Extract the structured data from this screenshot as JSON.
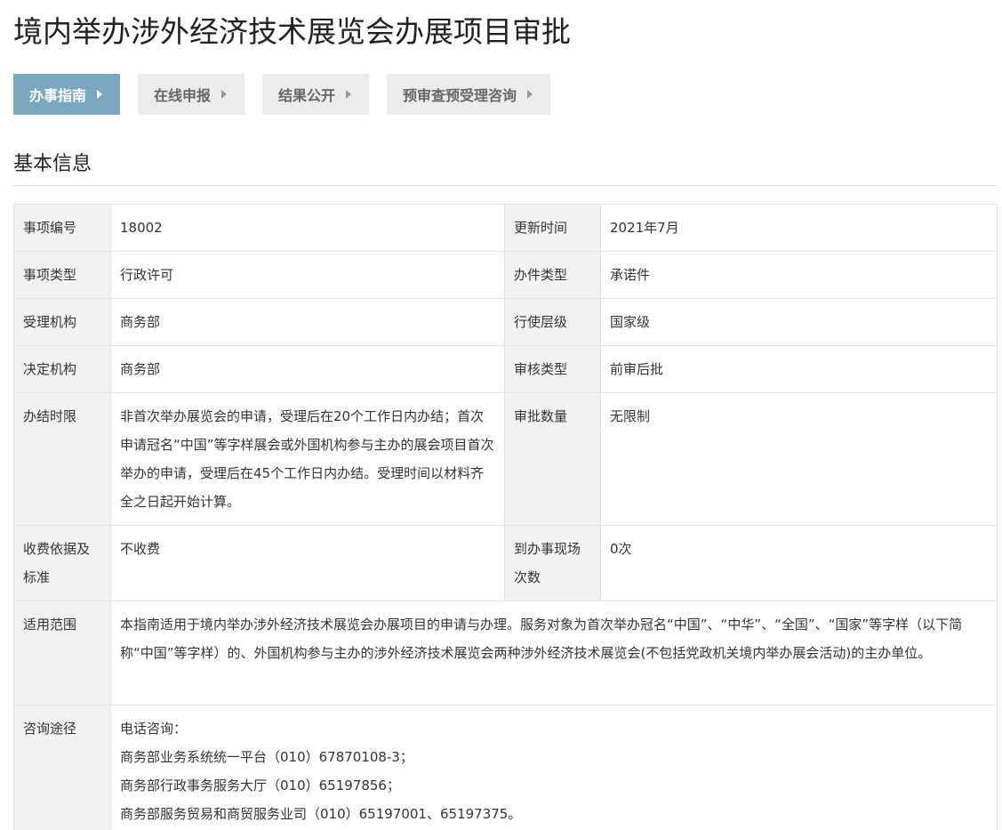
{
  "page_title": "境内举办涉外经济技术展览会办展项目审批",
  "tabs": [
    {
      "label": "办事指南",
      "active": true
    },
    {
      "label": "在线申报",
      "active": false
    },
    {
      "label": "结果公开",
      "active": false
    },
    {
      "label": "预审查预受理咨询",
      "active": false
    }
  ],
  "section_title": "基本信息",
  "info": {
    "item_no_label": "事项编号",
    "item_no": "18002",
    "update_time_label": "更新时间",
    "update_time": "2021年7月",
    "item_type_label": "事项类型",
    "item_type": "行政许可",
    "handle_type_label": "办件类型",
    "handle_type": "承诺件",
    "accept_org_label": "受理机构",
    "accept_org": "商务部",
    "level_label": "行使层级",
    "level": "国家级",
    "decide_org_label": "决定机构",
    "decide_org": "商务部",
    "review_type_label": "审核类型",
    "review_type": "前审后批",
    "time_limit_label": "办结时限",
    "time_limit": "非首次举办展览会的申请，受理后在20个工作日内办结；首次申请冠名“中国”等字样展会或外国机构参与主办的展会项目首次举办的申请，受理后在45个工作日内办结。受理时间以材料齐全之日起开始计算。",
    "approve_count_label": "审批数量",
    "approve_count": "无限制",
    "fee_label": "收费依据及标准",
    "fee": "不收费",
    "visits_label": "到办事现场次数",
    "visits": "0次",
    "scope_label": "适用范围",
    "scope": "本指南适用于境内举办涉外经济技术展览会办展项目的申请与办理。服务对象为首次举办冠名“中国”、“中华”、“全国”、“国家”等字样（以下简称“中国”等字样）的、外国机构参与主办的涉外经济技术展览会两种涉外经济技术展览会(不包括党政机关境内举办展会活动)的主办单位。",
    "consult_label": "咨询途径",
    "consult_lines": [
      "电话咨询：",
      "商务部业务系统统一平台（010）67870108-3；",
      "商务部行政事务服务大厅（010）65197856；",
      "商务部服务贸易和商贸服务业司（010）65197001、65197375。"
    ]
  }
}
